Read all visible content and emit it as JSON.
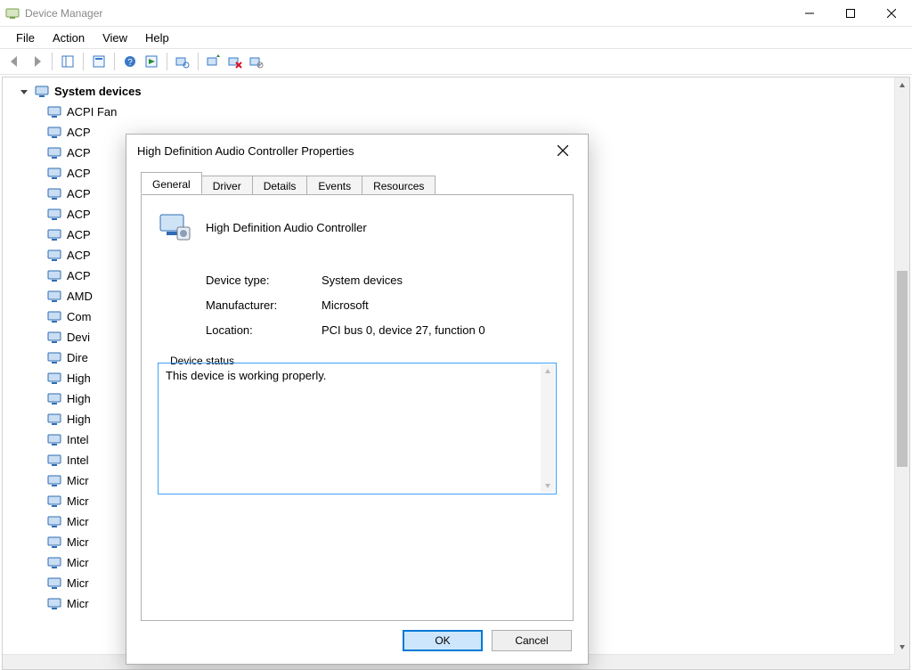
{
  "window": {
    "title": "Device Manager",
    "menus": [
      "File",
      "Action",
      "View",
      "Help"
    ]
  },
  "tree": {
    "root": "System devices",
    "children": [
      "ACPI Fan",
      "ACP",
      "ACP",
      "ACP",
      "ACP",
      "ACP",
      "ACP",
      "ACP",
      "ACP",
      "AMD",
      "Com",
      "Devi",
      "Dire",
      "High",
      "High",
      "High",
      "Intel",
      "Intel",
      "Micr",
      "Micr",
      "Micr",
      "Micr",
      "Micr",
      "Micr",
      "Micr"
    ]
  },
  "dialog": {
    "title": "High Definition Audio Controller Properties",
    "tabs": [
      "General",
      "Driver",
      "Details",
      "Events",
      "Resources"
    ],
    "active_tab": "General",
    "device_name": "High Definition Audio Controller",
    "props": {
      "device_type_label": "Device type:",
      "device_type_value": "System devices",
      "manufacturer_label": "Manufacturer:",
      "manufacturer_value": "Microsoft",
      "location_label": "Location:",
      "location_value": "PCI bus 0, device 27, function 0"
    },
    "status_label": "Device status",
    "status_text": "This device is working properly.",
    "ok_label": "OK",
    "cancel_label": "Cancel"
  }
}
